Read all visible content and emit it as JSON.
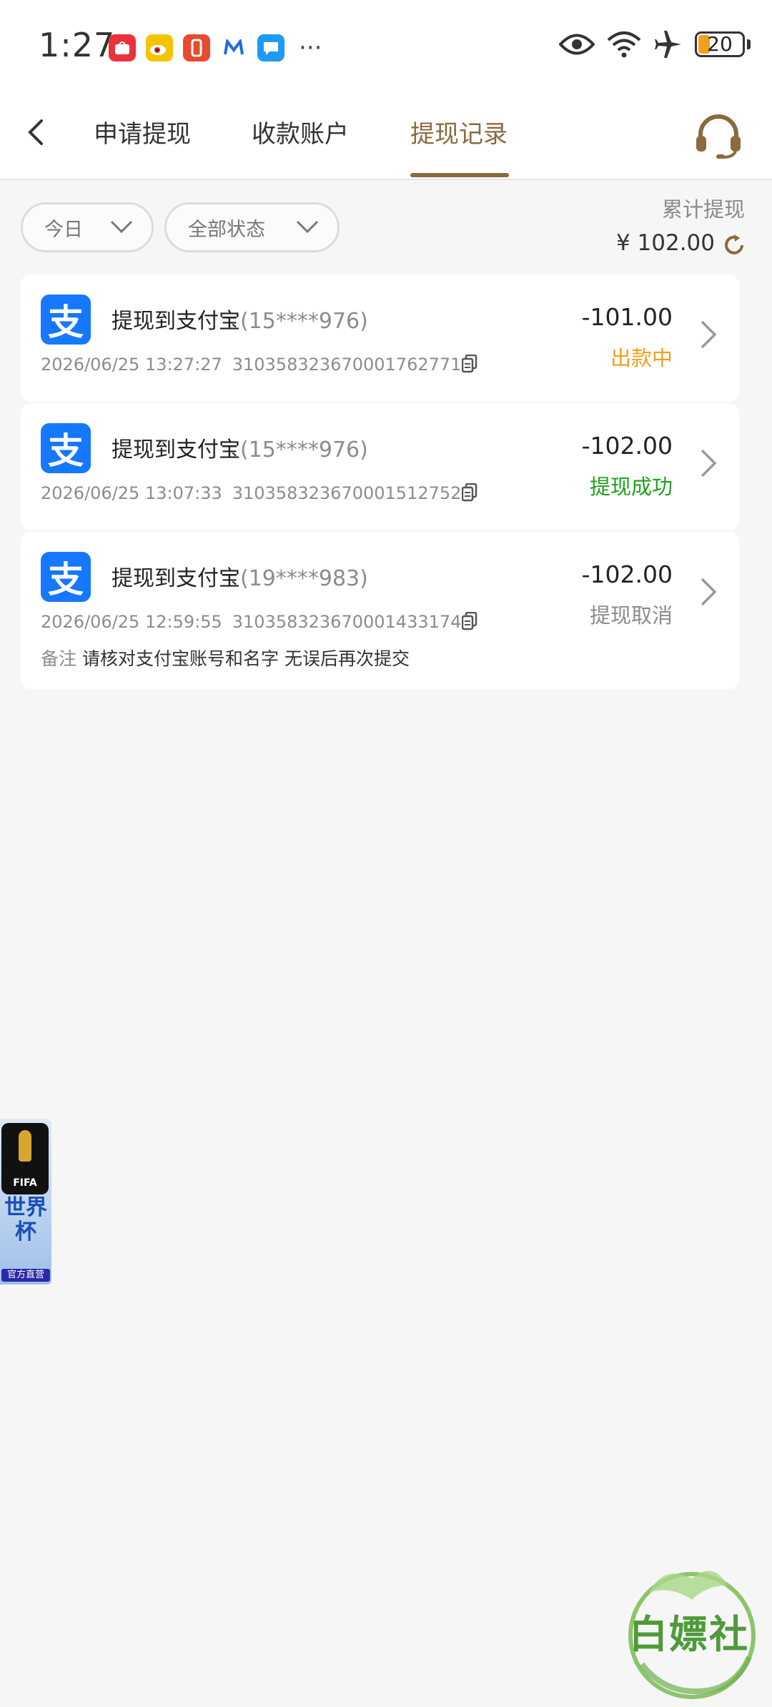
{
  "status_bar": {
    "time": "1:27",
    "battery": "20",
    "icons": [
      "huawei-store-icon",
      "weibo-icon",
      "app-icon",
      "app-m-icon",
      "chat-icon",
      "more-dots-icon",
      "eye-icon",
      "wifi-icon",
      "airplane-icon",
      "battery-icon"
    ],
    "more": "···"
  },
  "header": {
    "tabs": [
      {
        "label": "申请提现",
        "active": false
      },
      {
        "label": "收款账户",
        "active": false
      },
      {
        "label": "提现记录",
        "active": true
      }
    ],
    "accent_color": "#8a6a3e"
  },
  "filters": {
    "date": "今日",
    "status": "全部状态"
  },
  "summary": {
    "label": "累计提现",
    "amount": "¥ 102.00"
  },
  "records": [
    {
      "title": "提现到支付宝",
      "account": "(15****976)",
      "datetime": "2026/06/25 13:27:27",
      "order_no": "310358323670001762771",
      "amount": "-101.00",
      "status": "出款中",
      "status_color": "#f0a11c"
    },
    {
      "title": "提现到支付宝",
      "account": "(15****976)",
      "datetime": "2026/06/25 13:07:33",
      "order_no": "310358323670001512752",
      "amount": "-102.00",
      "status": "提现成功",
      "status_color": "#1ca21c"
    },
    {
      "title": "提现到支付宝",
      "account": "(19****983)",
      "datetime": "2026/06/25 12:59:55",
      "order_no": "310358323670001433174",
      "amount": "-102.00",
      "status": "提现取消",
      "status_color": "#8c8c8c",
      "note_label": "备注",
      "note": "请核对支付宝账号和名字 无误后再次提交"
    }
  ],
  "floating_ad": {
    "badge": "FIFA",
    "text": "世界杯",
    "tag": "官方直营"
  },
  "watermark": {
    "text": "白嫖社"
  }
}
